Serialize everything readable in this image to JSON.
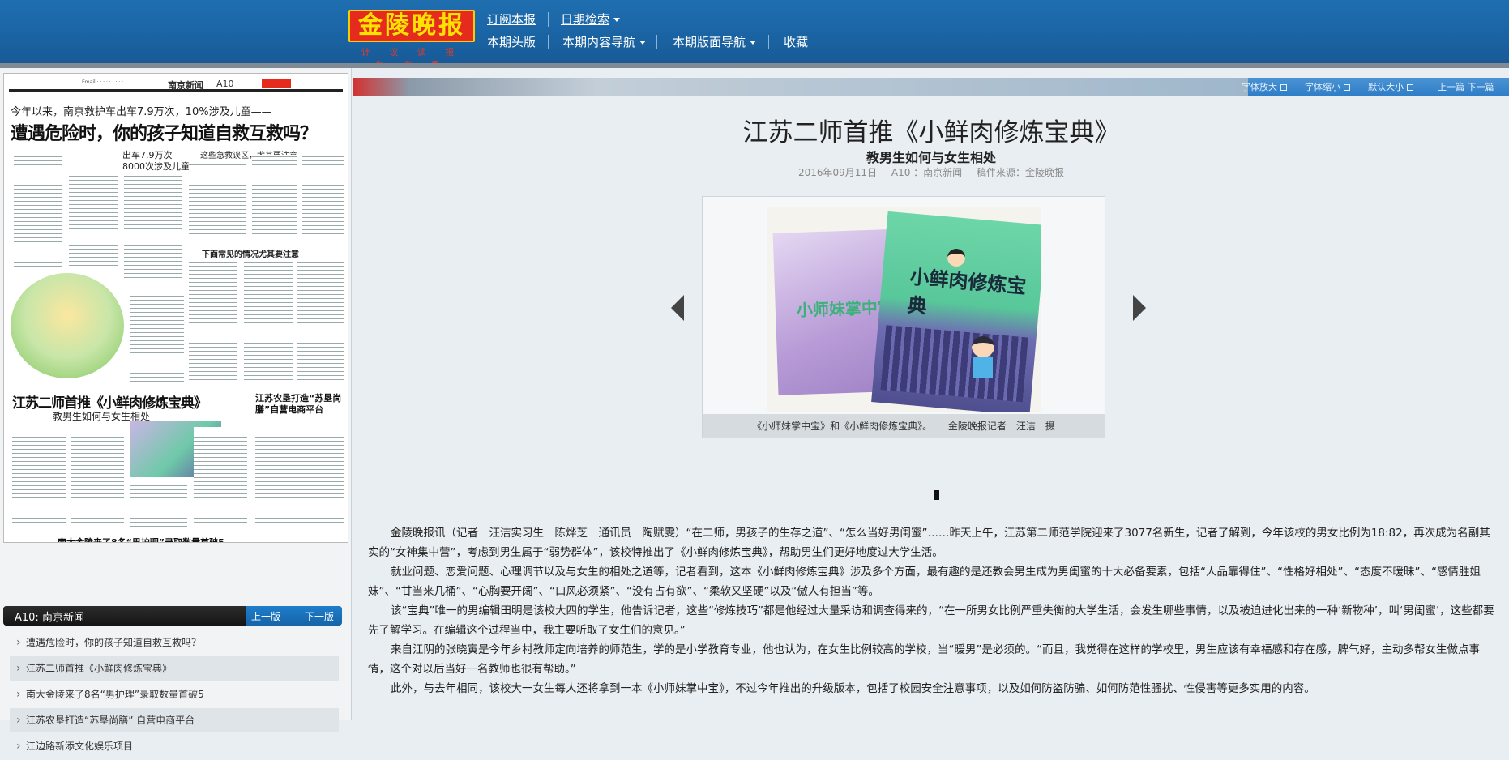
{
  "header": {
    "logo_text": "金陵晚报",
    "logo_slogan": "计 议 读 报 为 客 导",
    "nav_top": [
      "订阅本报",
      "日期检索"
    ],
    "nav_bottom": [
      "本期头版",
      "本期内容导航",
      "本期版面导航",
      "收藏"
    ]
  },
  "thumbnail": {
    "section": "南京新闻",
    "page": "A10",
    "kicker": "今年以来，南京救护车出车7.9万次，10%涉及儿童——",
    "headline": "遭遇危险时，你的孩子知道自救互救吗？",
    "sub1": "出车7.9万次",
    "sub2": "8000次涉及儿童",
    "sub3": "这些急救误区，尤其要注意",
    "sub4": "下面常见的情况尤其要注意",
    "headline2": "江苏二师首推《小鲜肉修炼宝典》",
    "headline2_sub": "教男生如何与女生相处",
    "headline3": "江苏农垦打造“苏垦尚膳”自营电商平台",
    "headline4": "南大金陵来了8名“男护理”录取数量首破5",
    "headline5": "江边路新添文化娱乐项目"
  },
  "pagebar": {
    "label": "A10: 南京新闻",
    "prev": "上一版",
    "next": "下一版"
  },
  "article_list": [
    "遭遇危险时，你的孩子知道自救互救吗？",
    "江苏二师首推《小鲜肉修炼宝典》",
    "南大金陵来了8名“男护理”录取数量首破5",
    "江苏农垦打造“苏垦尚膳” 自营电商平台",
    "江边路新添文化娱乐项目"
  ],
  "toolbar": {
    "font_size": "字体放大",
    "zoom_out": "字体缩小",
    "default": "默认大小",
    "nav": "上一篇 下一篇"
  },
  "article": {
    "title": "江苏二师首推《小鲜肉修炼宝典》",
    "subtitle": "教男生如何与女生相处",
    "date": "2016年09月11日",
    "page_info": "A10 ：南京新闻",
    "source": "稿件来源：金陵晚报",
    "photo": {
      "book1_title": "小师妹掌中宝",
      "book2_title": "小鲜肉修炼宝典",
      "caption": "《小师妹掌中宝》和《小鲜肉修炼宝典》。",
      "credit": "金陵晚报记者　汪洁　摄"
    },
    "paragraphs": [
      "金陵晚报讯（记者　汪洁实习生　陈烨芝　通讯员　陶赋雯）“在二师，男孩子的生存之道”、“怎么当好男闺蜜”……昨天上午，江苏第二师范学院迎来了3077名新生，记者了解到，今年该校的男女比例为18:82，再次成为名副其实的“女神集中营”，考虑到男生属于“弱势群体”，该校特推出了《小鲜肉修炼宝典》，帮助男生们更好地度过大学生活。",
      "就业问题、恋爱问题、心理调节以及与女生的相处之道等，记者看到，这本《小鲜肉修炼宝典》涉及多个方面，最有趣的是还教会男生成为男闺蜜的十大必备要素，包括“人品靠得住”、“性格好相处”、“态度不暧昧”、“感情胜姐妹”、“甘当来几桶”、“心胸要开阔”、“口风必须紧”、“没有占有欲”、“柔软又坚硬”以及“傲人有担当”等。",
      "该“宝典”唯一的男编辑田明是该校大四的学生，他告诉记者，这些“修炼技巧”都是他经过大量采访和调查得来的，“在一所男女比例严重失衡的大学生活，会发生哪些事情，以及被迫进化出来的一种‘新物种’，叫‘男闺蜜’，这些都要先了解学习。在编辑这个过程当中，我主要听取了女生们的意见。”",
      "来自江阴的张晓寅是今年乡村教师定向培养的师范生，学的是小学教育专业，他也认为，在女生比例较高的学校，当“暖男”是必须的。“而且，我觉得在这样的学校里，男生应该有幸福感和存在感，脾气好，主动多帮女生做点事情，这个对以后当好一名教师也很有帮助。”",
      "此外，与去年相同，该校大一女生每人还将拿到一本《小师妹掌中宝》，不过今年推出的升级版本，包括了校园安全注意事项，以及如何防盗防骗、如何防范性骚扰、性侵害等更多实用的内容。"
    ]
  }
}
